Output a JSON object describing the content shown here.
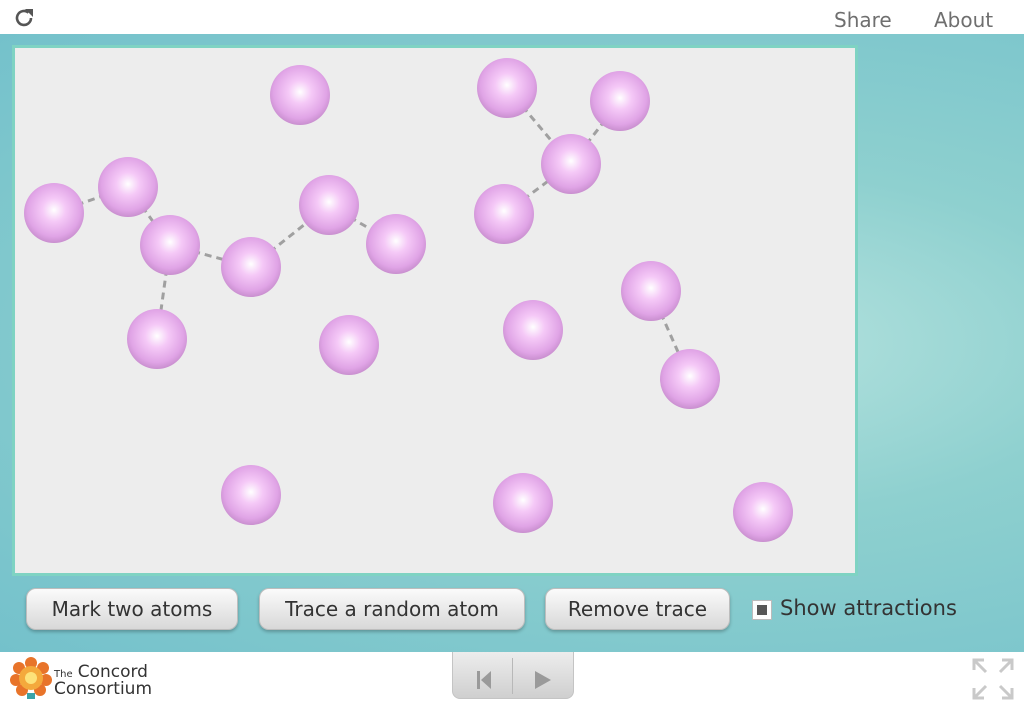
{
  "topbar": {
    "reload_icon": "reload-icon",
    "share_label": "Share",
    "about_label": "About"
  },
  "model": {
    "atom_color": "#e3a8ea",
    "bond_color": "#a0a0a0",
    "background": "#ededed",
    "border_color": "#7fd3c3"
  },
  "controls": {
    "mark_two_atoms_label": "Mark two atoms",
    "trace_random_atom_label": "Trace a random atom",
    "remove_trace_label": "Remove trace",
    "show_attractions_label": "Show attractions",
    "show_attractions_checked": true
  },
  "bottombar": {
    "logo_icon": "concord-lightbulb-icon",
    "logo_line1_small": "The",
    "logo_line1_big": "Concord",
    "logo_line2": "Consortium",
    "reset_icon": "skip-to-start-icon",
    "play_icon": "play-icon",
    "fullscreen_icon": "fullscreen-icon"
  }
}
